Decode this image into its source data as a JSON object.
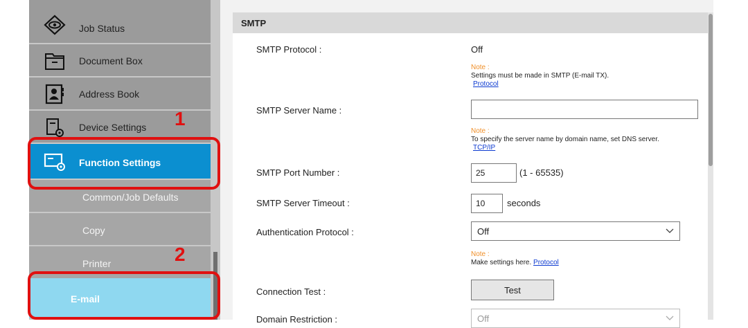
{
  "sidebar": {
    "items": [
      {
        "label": "Job Status",
        "icon": "eye-icon"
      },
      {
        "label": "Document Box",
        "icon": "folder-icon"
      },
      {
        "label": "Address Book",
        "icon": "address-book-icon"
      },
      {
        "label": "Device Settings",
        "icon": "device-settings-icon"
      },
      {
        "label": "Function Settings",
        "icon": "function-settings-icon"
      }
    ],
    "subitems": [
      {
        "label": "Common/Job Defaults"
      },
      {
        "label": "Copy"
      },
      {
        "label": "Printer"
      },
      {
        "label": "E-mail"
      }
    ]
  },
  "callouts": {
    "one": "1",
    "two": "2",
    "color": "#e01010"
  },
  "section": {
    "title": "SMTP"
  },
  "form": {
    "smtp_protocol": {
      "label": "SMTP Protocol :",
      "value": "Off"
    },
    "note1": {
      "title": "Note :",
      "text": "Settings must be made in SMTP (E-mail TX).",
      "link": "Protocol"
    },
    "server_name": {
      "label": "SMTP Server Name :",
      "value": ""
    },
    "note2": {
      "title": "Note :",
      "text": "To specify the server name by domain name, set DNS server.",
      "link": "TCP/IP"
    },
    "port": {
      "label": "SMTP Port Number :",
      "value": "25",
      "range": "(1 - 65535)"
    },
    "timeout": {
      "label": "SMTP Server Timeout :",
      "value": "10",
      "unit": "seconds"
    },
    "auth": {
      "label": "Authentication Protocol :",
      "value": "Off"
    },
    "note3": {
      "title": "Note :",
      "text": "Make settings here.",
      "link": "Protocol"
    },
    "connection_test": {
      "label": "Connection Test :",
      "button": "Test"
    },
    "domain_restriction": {
      "label": "Domain Restriction :",
      "value": "Off"
    }
  },
  "colors": {
    "active": "#0b8fd0",
    "email_bg": "#8fd8f0",
    "note": "#f0902a",
    "link": "#0b39d0"
  }
}
